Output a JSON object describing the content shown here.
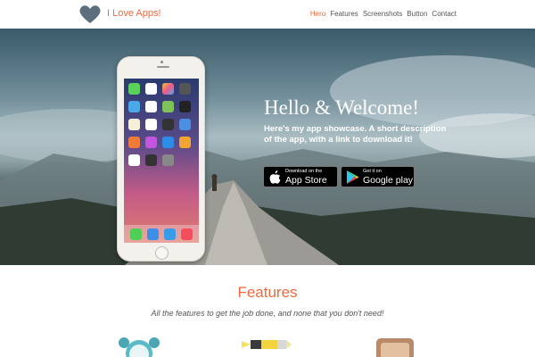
{
  "brand": {
    "name": "I Love Apps!",
    "logo_icon": "heart-icon",
    "accent": "#f2683e",
    "logo_color": "#5b6f7d"
  },
  "nav": {
    "items": [
      {
        "label": "Hero",
        "active": true
      },
      {
        "label": "Features",
        "active": false
      },
      {
        "label": "Screenshots",
        "active": false
      },
      {
        "label": "Button",
        "active": false
      },
      {
        "label": "Contact",
        "active": false
      }
    ]
  },
  "hero": {
    "title": "Hello & Welcome!",
    "description": "Here's my app showcase. A short description of the app, with a link to download it!",
    "buttons": [
      {
        "small": "Download on the",
        "big": "App Store",
        "icon": "apple-icon"
      },
      {
        "small": "Get it on",
        "big": "Google play",
        "icon": "google-play-icon"
      }
    ]
  },
  "features": {
    "title": "Features",
    "subtitle": "All the features to get the job done, and none that you don't need!",
    "icons": [
      "alarm-clock-icon",
      "pencil-icon",
      "wallet-icon"
    ]
  }
}
